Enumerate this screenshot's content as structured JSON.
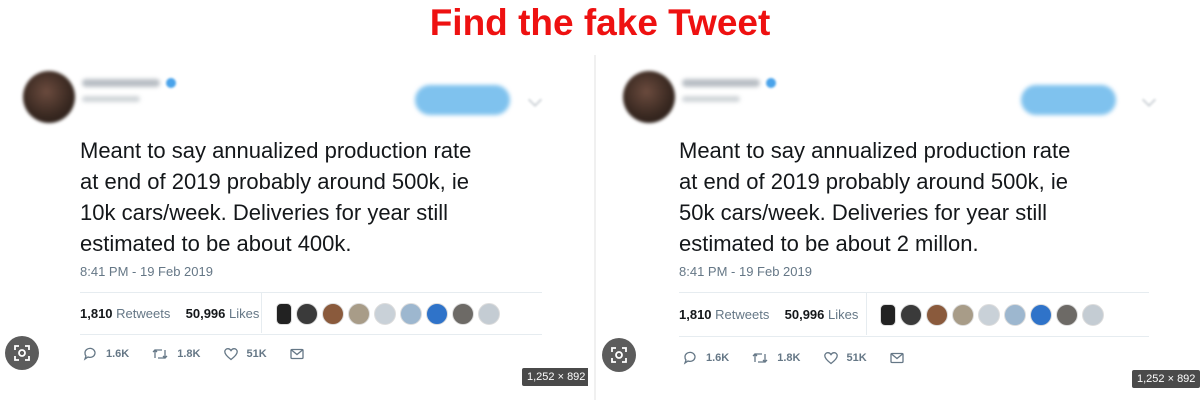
{
  "headline": "Find the fake Tweet",
  "colors": {
    "headline": "#ee1111",
    "follow_button": "#7fc2ee",
    "verified": "#4aa3ea",
    "meta_text": "#657786"
  },
  "left_tweet": {
    "text_lines": [
      "Meant to say annualized production rate",
      "at end of 2019 probably around 500k, ie",
      "10k cars/week. Deliveries for year still",
      "estimated to be about 400k."
    ],
    "timestamp": "8:41 PM - 19 Feb 2019",
    "retweets_count": "1,810",
    "retweets_label": "Retweets",
    "likes_count": "50,996",
    "likes_label": "Likes",
    "replies": "1.6K",
    "retweet_action": "1.8K",
    "like_action": "51K",
    "image_size": "1,252 × 892"
  },
  "right_tweet": {
    "text_lines": [
      "Meant to say annualized production rate",
      "at end of 2019 probably around 500k, ie",
      "50k cars/week. Deliveries for year still",
      "estimated to be about 2 millon."
    ],
    "timestamp": "8:41 PM - 19 Feb 2019",
    "retweets_count": "1,810",
    "retweets_label": "Retweets",
    "likes_count": "50,996",
    "likes_label": "Likes",
    "replies": "1.6K",
    "retweet_action": "1.8K",
    "like_action": "51K",
    "image_size": "1,252 × 892"
  },
  "icons": [
    "reply-icon",
    "retweet-icon",
    "like-icon",
    "message-icon",
    "visual-search-icon"
  ]
}
